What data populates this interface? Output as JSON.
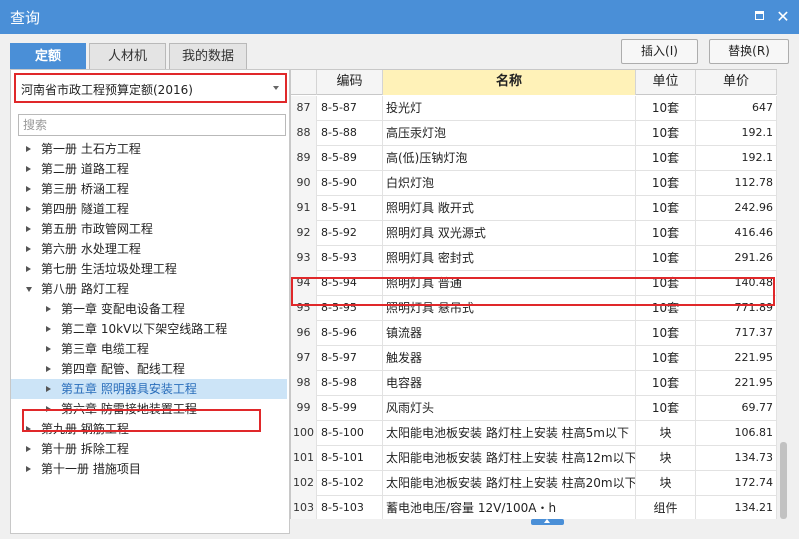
{
  "window": {
    "title": "查询"
  },
  "tabs": [
    {
      "label": "定额"
    },
    {
      "label": "人材机"
    },
    {
      "label": "我的数据"
    }
  ],
  "actions": {
    "insert_label": "插入(I)",
    "replace_label": "替换(R)"
  },
  "quota_select": {
    "value": "河南省市政工程预算定额(2016)"
  },
  "search": {
    "placeholder": "搜索"
  },
  "tree": [
    {
      "label": "第一册  土石方工程"
    },
    {
      "label": "第二册  道路工程"
    },
    {
      "label": "第三册  桥涵工程"
    },
    {
      "label": "第四册  隧道工程"
    },
    {
      "label": "第五册  市政管网工程"
    },
    {
      "label": "第六册  水处理工程"
    },
    {
      "label": "第七册  生活垃圾处理工程"
    },
    {
      "label": "第八册  路灯工程"
    },
    {
      "label": "第一章  变配电设备工程"
    },
    {
      "label": "第二章  10kV以下架空线路工程"
    },
    {
      "label": "第三章  电缆工程"
    },
    {
      "label": "第四章  配管、配线工程"
    },
    {
      "label": "第五章  照明器具安装工程"
    },
    {
      "label": "第六章  防雷接地装置工程"
    },
    {
      "label": "第九册  钢筋工程"
    },
    {
      "label": "第十册  拆除工程"
    },
    {
      "label": "第十一册  措施项目"
    }
  ],
  "grid": {
    "headers": {
      "code": "编码",
      "name": "名称",
      "unit": "单位",
      "price": "单价"
    },
    "rows": [
      {
        "idx": "87",
        "code": "8-5-87",
        "name": "投光灯",
        "unit": "10套",
        "price": "647"
      },
      {
        "idx": "88",
        "code": "8-5-88",
        "name": "高压汞灯泡",
        "unit": "10套",
        "price": "192.1"
      },
      {
        "idx": "89",
        "code": "8-5-89",
        "name": "高(低)压钠灯泡",
        "unit": "10套",
        "price": "192.1"
      },
      {
        "idx": "90",
        "code": "8-5-90",
        "name": "白炽灯泡",
        "unit": "10套",
        "price": "112.78"
      },
      {
        "idx": "91",
        "code": "8-5-91",
        "name": "照明灯具 敞开式",
        "unit": "10套",
        "price": "242.96"
      },
      {
        "idx": "92",
        "code": "8-5-92",
        "name": "照明灯具 双光源式",
        "unit": "10套",
        "price": "416.46"
      },
      {
        "idx": "93",
        "code": "8-5-93",
        "name": "照明灯具 密封式",
        "unit": "10套",
        "price": "291.26"
      },
      {
        "idx": "94",
        "code": "8-5-94",
        "name": "照明灯具 普通",
        "unit": "10套",
        "price": "140.48"
      },
      {
        "idx": "95",
        "code": "8-5-95",
        "name": "照明灯具 悬吊式",
        "unit": "10套",
        "price": "771.89"
      },
      {
        "idx": "96",
        "code": "8-5-96",
        "name": "镇流器",
        "unit": "10套",
        "price": "717.37"
      },
      {
        "idx": "97",
        "code": "8-5-97",
        "name": "触发器",
        "unit": "10套",
        "price": "221.95"
      },
      {
        "idx": "98",
        "code": "8-5-98",
        "name": "电容器",
        "unit": "10套",
        "price": "221.95"
      },
      {
        "idx": "99",
        "code": "8-5-99",
        "name": "风雨灯头",
        "unit": "10套",
        "price": "69.77"
      },
      {
        "idx": "100",
        "code": "8-5-100",
        "name": "太阳能电池板安装 路灯柱上安装 柱高5m以下",
        "unit": "块",
        "price": "106.81"
      },
      {
        "idx": "101",
        "code": "8-5-101",
        "name": "太阳能电池板安装 路灯柱上安装 柱高12m以下",
        "unit": "块",
        "price": "134.73"
      },
      {
        "idx": "102",
        "code": "8-5-102",
        "name": "太阳能电池板安装 路灯柱上安装 柱高20m以下",
        "unit": "块",
        "price": "172.74"
      },
      {
        "idx": "103",
        "code": "8-5-103",
        "name": "蓄电池电压/容量 12V/100A・h",
        "unit": "组件",
        "price": "134.21"
      }
    ]
  }
}
